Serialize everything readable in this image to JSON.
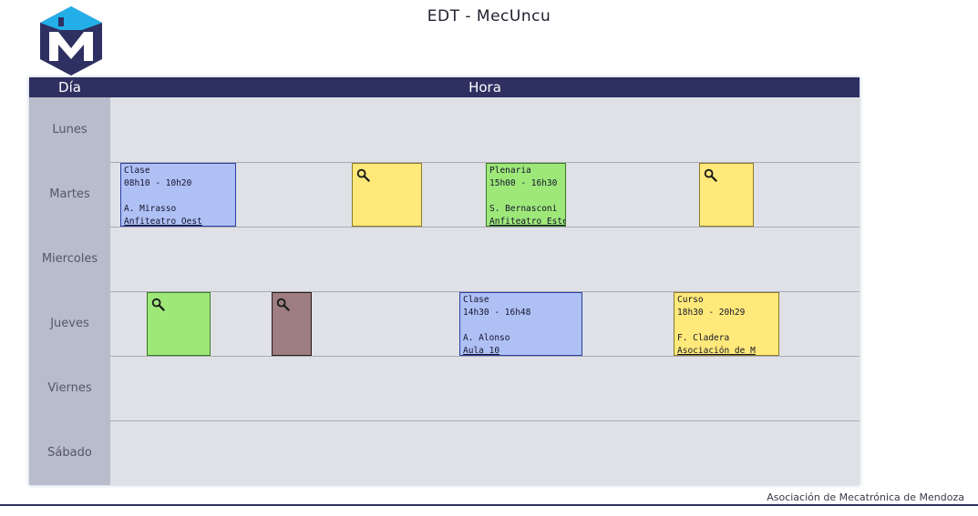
{
  "header": {
    "title": "EDT - MecUncu"
  },
  "table": {
    "day_header": "Día",
    "hour_header": "Hora"
  },
  "days": [
    "Lunes",
    "Martes",
    "Miercoles",
    "Jueves",
    "Viernes",
    "Sábado"
  ],
  "events": {
    "martes_clase": {
      "type": "Clase",
      "time": "08h10 - 10h20",
      "person": "A. Mirasso",
      "place": "Anfiteatro Oest"
    },
    "martes_plenaria": {
      "type": "Plenaria",
      "time": "15h00 - 16h30",
      "person": "S. Bernasconi",
      "place": "Anfiteatro Este"
    },
    "jueves_clase": {
      "type": "Clase",
      "time": "14h30 - 16h48",
      "person": "A. Alonso",
      "place": "Aula 10"
    },
    "jueves_curso": {
      "type": "Curso",
      "time": "18h30 - 20h29",
      "person": "F. Cladera",
      "place": "Asociación de M"
    }
  },
  "colors": {
    "header_bg": "#2e3061",
    "clase_blue": "#afc0f5",
    "plenaria_green": "#9ee87a",
    "curso_yellow": "#ffe97a",
    "brown_block": "#9e7e80",
    "day_column": "#b9bccb",
    "grid_bg": "#dfe1e6"
  },
  "icons": {
    "preview": "magnifier-icon",
    "logo": "mecatronica-m-logo"
  },
  "footer": {
    "text": "Asociación de Mecatrónica de Mendoza"
  }
}
